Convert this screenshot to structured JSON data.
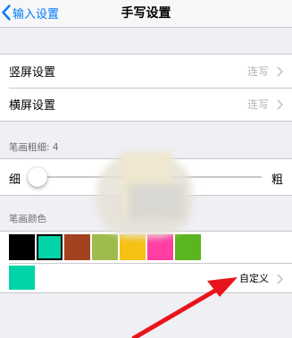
{
  "nav": {
    "back_label": "输入设置",
    "title": "手写设置"
  },
  "orientation": {
    "rows": [
      {
        "label": "竖屏设置",
        "value": "连写"
      },
      {
        "label": "横屏设置",
        "value": "连写"
      }
    ]
  },
  "stroke_width": {
    "header": "笔画粗细: 4",
    "min_label": "细",
    "max_label": "粗",
    "value_fraction": 0.03
  },
  "stroke_color": {
    "header": "笔画颜色",
    "swatches": [
      "#000000",
      "#00d4a6",
      "#a3421f",
      "#9ebc4d",
      "#f5c213",
      "#ff3da2",
      "#5ab51f"
    ],
    "selected_index": 1,
    "current_color": "#00d4a6",
    "custom_label": "自定义"
  },
  "annotation": {
    "arrow_color": "#e8141b"
  }
}
